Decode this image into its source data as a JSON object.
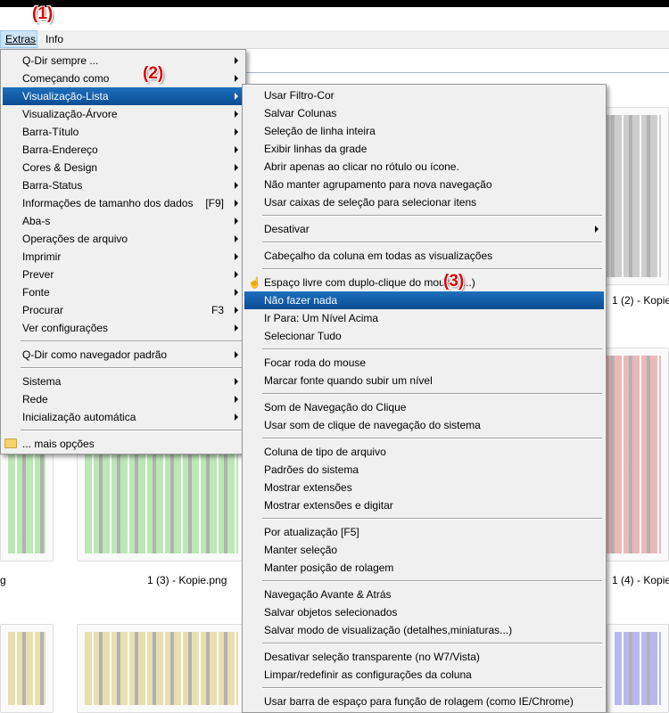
{
  "callouts": {
    "one": "(1)",
    "two": "(2)",
    "three": "(3)"
  },
  "menubar": {
    "extras": "Extras",
    "info": "Info"
  },
  "extras_menu": [
    {
      "label": "Q-Dir sempre ...",
      "shortcut": "",
      "submenu": true
    },
    {
      "label": "Começando como",
      "shortcut": "",
      "submenu": true
    },
    {
      "label": "Visualização-Lista",
      "shortcut": "",
      "submenu": true,
      "highlighted": true
    },
    {
      "label": "Visualização-Árvore",
      "shortcut": "",
      "submenu": true
    },
    {
      "label": "Barra-Título",
      "shortcut": "",
      "submenu": true
    },
    {
      "label": "Barra-Endereço",
      "shortcut": "",
      "submenu": true
    },
    {
      "label": "Cores & Design",
      "shortcut": "",
      "submenu": true
    },
    {
      "label": "Barra-Status",
      "shortcut": "",
      "submenu": true
    },
    {
      "label": "Informações de tamanho dos dados",
      "shortcut": "[F9]",
      "submenu": true
    },
    {
      "label": "Aba-s",
      "shortcut": "",
      "submenu": true
    },
    {
      "label": "Operações de arquivo",
      "shortcut": "",
      "submenu": true
    },
    {
      "label": "Imprimir",
      "shortcut": "",
      "submenu": true
    },
    {
      "label": "Prever",
      "shortcut": "",
      "submenu": true
    },
    {
      "label": "Fonte",
      "shortcut": "",
      "submenu": true
    },
    {
      "label": "Procurar",
      "shortcut": "F3",
      "submenu": true
    },
    {
      "label": "Ver configurações",
      "shortcut": "",
      "submenu": true
    },
    {
      "sep": true
    },
    {
      "label": "Q-Dir como navegador padrão",
      "shortcut": "",
      "submenu": true
    },
    {
      "sep": true
    },
    {
      "label": "Sistema",
      "shortcut": "",
      "submenu": true
    },
    {
      "label": "Rede",
      "shortcut": "",
      "submenu": true
    },
    {
      "label": "Inicialização automática",
      "shortcut": "",
      "submenu": true
    },
    {
      "sep": true
    },
    {
      "label": "... mais opções",
      "shortcut": "",
      "submenu": false,
      "icon": "folder-icon"
    }
  ],
  "list_submenu": [
    {
      "label": "Usar Filtro-Cor"
    },
    {
      "label": "Salvar Colunas"
    },
    {
      "label": "Seleção de linha inteira"
    },
    {
      "label": "Exibir linhas da grade"
    },
    {
      "label": "Abrir apenas ao clicar no rótulo ou ícone."
    },
    {
      "label": "Não manter agrupamento para nova navegação"
    },
    {
      "label": "Usar caixas de seleção para selecionar itens"
    },
    {
      "sep": true
    },
    {
      "label": "Desativar",
      "submenu": true
    },
    {
      "sep": true
    },
    {
      "label": "Cabeçalho da coluna em todas as visualizações"
    },
    {
      "sep": true
    },
    {
      "label": "Espaço livre com duplo-clique do mouse (...)",
      "icon": "hand-pointer-icon"
    },
    {
      "label": "Não fazer nada",
      "highlighted": true
    },
    {
      "label": "Ir Para: Um Nível Acima"
    },
    {
      "label": "Selecionar Tudo"
    },
    {
      "sep": true
    },
    {
      "label": "Focar roda do mouse"
    },
    {
      "label": "Marcar fonte quando subir um nível"
    },
    {
      "sep": true
    },
    {
      "label": "Som de Navegação do Clique"
    },
    {
      "label": "Usar som de clique de navegação do sistema"
    },
    {
      "sep": true
    },
    {
      "label": "Coluna de tipo de arquivo"
    },
    {
      "label": "Padrões do sistema"
    },
    {
      "label": "Mostrar extensões"
    },
    {
      "label": "Mostrar extensões e digitar"
    },
    {
      "sep": true
    },
    {
      "label": "Por atualização [F5]"
    },
    {
      "label": "Manter seleção"
    },
    {
      "label": "Manter posição de rolagem"
    },
    {
      "sep": true
    },
    {
      "label": "Navegação Avante & Atrás"
    },
    {
      "label": "Salvar objetos selecionados"
    },
    {
      "label": "Salvar modo de visualização (detalhes,miniaturas...)"
    },
    {
      "sep": true
    },
    {
      "label": "Desativar seleção transparente (no W7/Vista)"
    },
    {
      "label": "Limpar/redefinir as configurações da coluna"
    },
    {
      "sep": true
    },
    {
      "label": "Usar barra de espaço para função de rolagem (como IE/Chrome)"
    }
  ],
  "files": {
    "kopie2": "1 (2) - Kopie",
    "kopie3": "1 (3) - Kopie.png",
    "kopie4": "1 (4) - Kopie",
    "fragment_g": "g"
  },
  "colors": {
    "highlight": "#0b4d93",
    "callout": "#d90000",
    "thumb_gray": "#c8c8c8",
    "thumb_red": "#eab0b0",
    "thumb_green": "#b4e6ad",
    "thumb_yellow": "#e6dca5",
    "thumb_blue": "#b0b0f0"
  }
}
